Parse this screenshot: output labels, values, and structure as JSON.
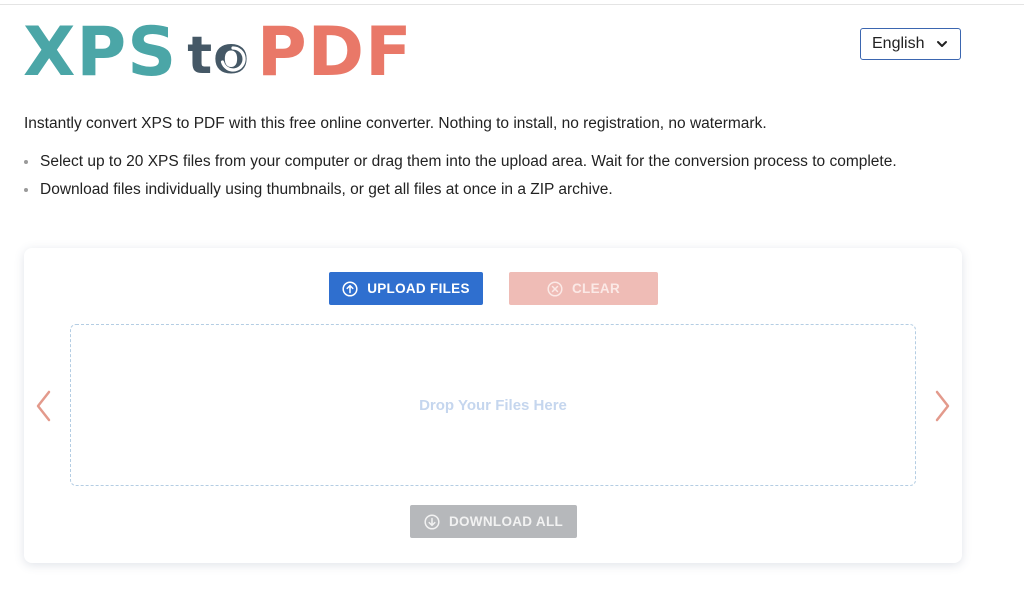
{
  "logo": {
    "part1": "XPS",
    "part2": "to",
    "part3": "PDF",
    "colors": {
      "xps": "#4ba6a7",
      "to": "#455866",
      "pdf": "#e97868"
    }
  },
  "language": {
    "selected": "English",
    "icon": "chevron-down-icon"
  },
  "intro": "Instantly convert XPS to PDF with this free online converter. Nothing to install, no registration, no watermark.",
  "bullets": [
    "Select up to 20 XPS files from your computer or drag them into the upload area. Wait for the conversion process to complete.",
    "Download files individually using thumbnails, or get all files at once in a ZIP archive."
  ],
  "converter": {
    "upload_label": "UPLOAD FILES",
    "upload_icon": "arrow-up-circle-icon",
    "clear_label": "CLEAR",
    "clear_icon": "x-circle-icon",
    "drop_hint": "Drop Your Files Here",
    "download_all_label": "DOWNLOAD ALL",
    "download_icon": "arrow-down-circle-icon",
    "prev_icon": "chevron-left-icon",
    "next_icon": "chevron-right-icon",
    "colors": {
      "upload": "#2f6fcf",
      "clear": "#efbcb6",
      "download": "#b6b8bb",
      "arrows": "#e39a8c"
    }
  }
}
